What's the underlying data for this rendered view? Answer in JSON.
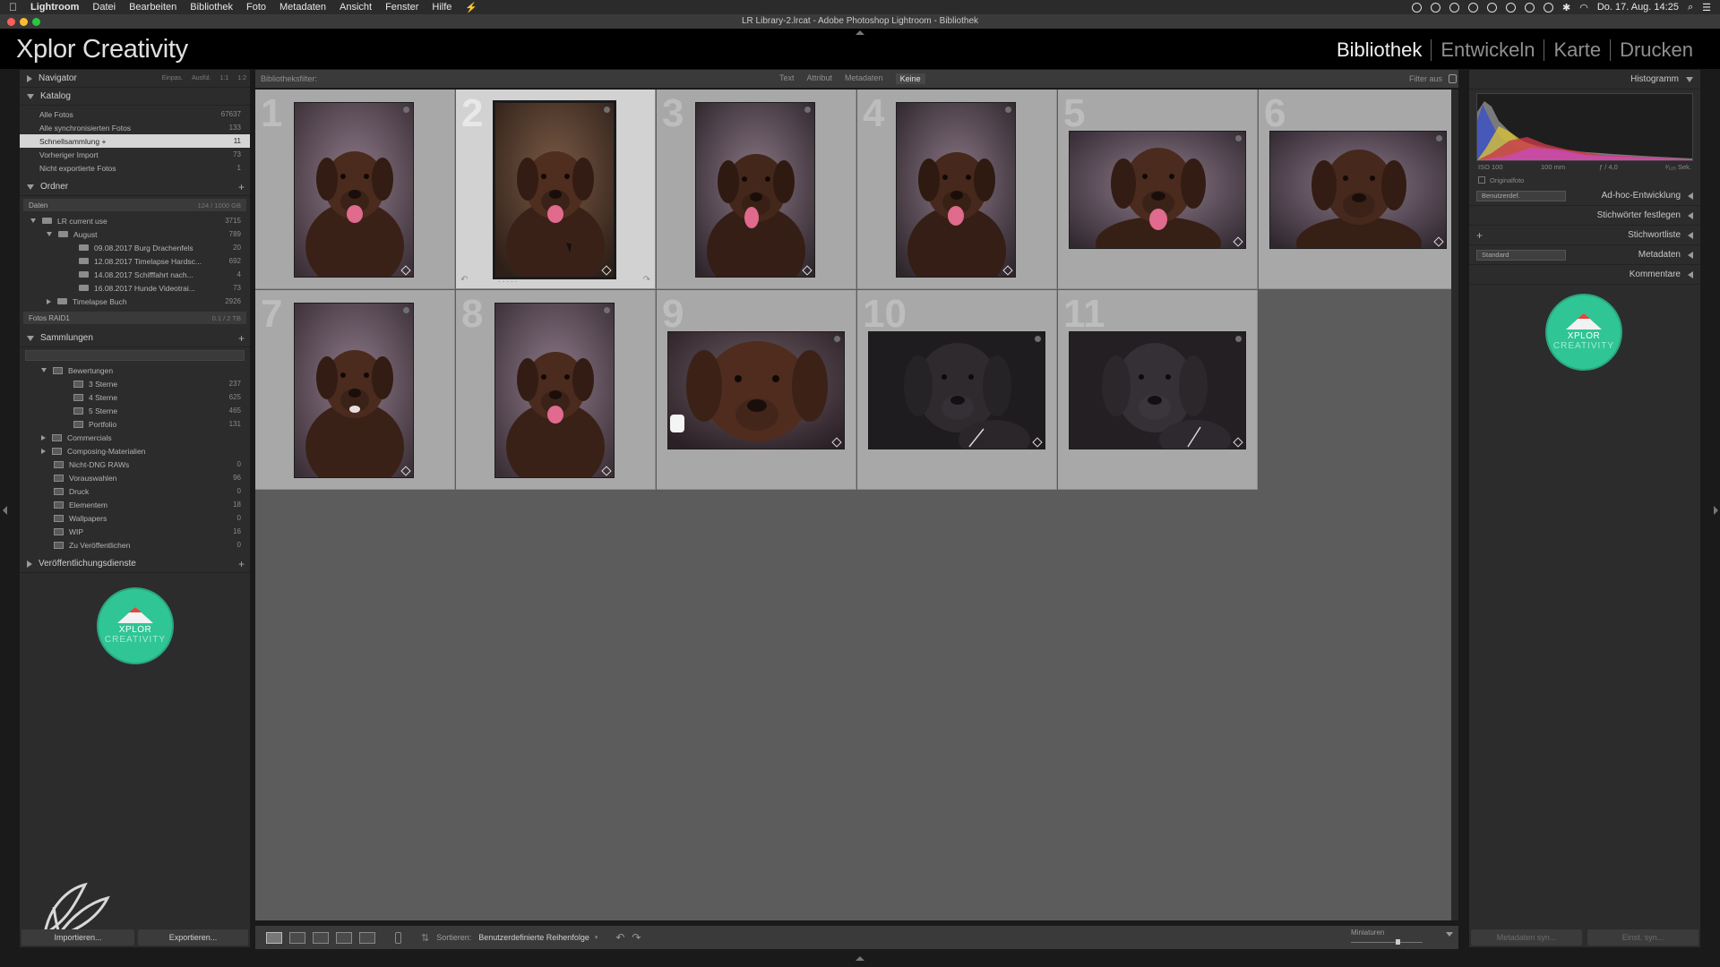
{
  "menubar": {
    "app": "Lightroom",
    "items": [
      "Datei",
      "Bearbeiten",
      "Bibliothek",
      "Foto",
      "Metadaten",
      "Ansicht",
      "Fenster",
      "Hilfe"
    ],
    "clock": "Do. 17. Aug.  14:25"
  },
  "window": {
    "title": "LR Library-2.lrcat - Adobe Photoshop Lightroom - Bibliothek"
  },
  "identity": {
    "brand": "Xplor Creativity",
    "modules": [
      "Bibliothek",
      "Entwickeln",
      "Karte",
      "Drucken"
    ],
    "active_module": "Bibliothek"
  },
  "navigator": {
    "title": "Navigator",
    "zoom_options": [
      "Einpas.",
      "Ausfül.",
      "1:1",
      "1:2"
    ]
  },
  "catalog": {
    "title": "Katalog",
    "items": [
      {
        "label": "Alle Fotos",
        "count": "67637"
      },
      {
        "label": "Alle synchronisierten Fotos",
        "count": "133"
      },
      {
        "label": "Schnellsammlung +",
        "count": "11"
      },
      {
        "label": "Vorheriger Import",
        "count": "73"
      },
      {
        "label": "Nicht exportierte Fotos",
        "count": "1"
      }
    ]
  },
  "folders": {
    "title": "Ordner",
    "volume1": {
      "label": "Daten",
      "count": "124 / 1000 GB"
    },
    "items": [
      {
        "label": "LR current use",
        "count": "3715"
      },
      {
        "label": "August",
        "count": "789"
      },
      {
        "label": "09.08.2017 Burg Drachenfels",
        "count": "20"
      },
      {
        "label": "12.08.2017 Timelapse Hardsc...",
        "count": "692"
      },
      {
        "label": "14.08.2017 Schifffahrt nach...",
        "count": "4"
      },
      {
        "label": "16.08.2017 Hunde Videotrai...",
        "count": "73"
      },
      {
        "label": "Timelapse Buch",
        "count": "2926"
      }
    ],
    "volume2": {
      "label": "Fotos RAID1",
      "count": "0.1 / 2 TB"
    }
  },
  "collections": {
    "title": "Sammlungen",
    "items": [
      {
        "label": "Bewertungen",
        "count": ""
      },
      {
        "label": "3 Sterne",
        "count": "237"
      },
      {
        "label": "4 Sterne",
        "count": "625"
      },
      {
        "label": "5 Sterne",
        "count": "465"
      },
      {
        "label": "Portfolio",
        "count": "131"
      },
      {
        "label": "Commercials",
        "count": ""
      },
      {
        "label": "Composing-Materialien",
        "count": ""
      },
      {
        "label": "Nicht-DNG RAWs",
        "count": "0"
      },
      {
        "label": "Vorauswahlen",
        "count": "96"
      },
      {
        "label": "Druck",
        "count": "0"
      },
      {
        "label": "Elementem",
        "count": "18"
      },
      {
        "label": "Wallpapers",
        "count": "0"
      },
      {
        "label": "WIP",
        "count": "16"
      },
      {
        "label": "Zu Veröffentlichen",
        "count": "0"
      }
    ]
  },
  "publish": {
    "title": "Veröffentlichungsdienste"
  },
  "logo": {
    "line1": "XPLOR",
    "line2": "CREATIVITY"
  },
  "left_buttons": {
    "import": "Importieren...",
    "export": "Exportieren..."
  },
  "filterbar": {
    "label": "Bibliotheksfilter:",
    "tabs": [
      "Text",
      "Attribut",
      "Metadaten",
      "Keine"
    ],
    "active_tab": "Keine",
    "right": "Filter aus"
  },
  "grid": {
    "cells": [
      "1",
      "2",
      "3",
      "4",
      "5",
      "6",
      "7",
      "8",
      "9",
      "10",
      "11"
    ],
    "selected": "2"
  },
  "toolbar": {
    "sort_label": "Sortieren:",
    "sort_value": "Benutzerdefinierte Reihenfolge",
    "thumbs_label": "Miniaturen"
  },
  "right_panel": {
    "histogram_title": "Histogramm",
    "histo_info": [
      "ISO 100",
      "100 mm",
      "ƒ / 4,0",
      "¹⁄₁₂₅ Sek."
    ],
    "original_photo": "Originalfoto",
    "quick_develop": "Ad-hoc-Entwicklung",
    "quick_develop_preset": "Benutzerdef.",
    "keywording": "Stichwörter festlegen",
    "keyword_list": "Stichwortliste",
    "metadata": "Metadaten",
    "metadata_preset": "Standard",
    "comments": "Kommentare",
    "sync_buttons": [
      "Metadaten syn...",
      "Einst. syn..."
    ]
  },
  "colors": {
    "accent_logo": "#2fc595",
    "selected_cell": "#d2d2d2",
    "grid_bg": "#5c5c5c"
  }
}
